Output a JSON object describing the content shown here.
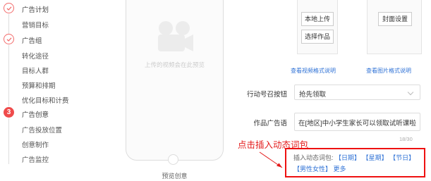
{
  "sidebar": {
    "items": [
      {
        "label": "广告计划",
        "kind": "step-done"
      },
      {
        "label": "营销目标",
        "kind": "sub"
      },
      {
        "label": "广告组",
        "kind": "step-done"
      },
      {
        "label": "转化途径",
        "kind": "sub"
      },
      {
        "label": "目标人群",
        "kind": "sub"
      },
      {
        "label": "预算和排期",
        "kind": "sub"
      },
      {
        "label": "优化目标和计费",
        "kind": "sub"
      },
      {
        "label": "广告创意",
        "kind": "step-active",
        "step_number": "3"
      },
      {
        "label": "广告投放位置",
        "kind": "sub"
      },
      {
        "label": "创意制作",
        "kind": "sub"
      },
      {
        "label": "广告监控",
        "kind": "sub"
      }
    ],
    "accent_color": "#ef4b4b"
  },
  "preview": {
    "placeholder": "上传的视频会在此预览",
    "label": "预览创意"
  },
  "upload": {
    "local_upload": "本地上传",
    "choose_work": "选择作品",
    "cover_setting": "封面设置",
    "video_spec_link": "查看视频格式说明",
    "image_spec_link": "查看图片格式说明"
  },
  "form": {
    "cta_label": "行动号召按钮",
    "cta_value": "抢先领取",
    "copy_label": "作品广告语",
    "copy_value": "在[地区]中小学生家长可以领取试听课啦",
    "counter": "18/30"
  },
  "dynamic_words": {
    "prefix": "插入动态词包:",
    "tags": [
      "【日期】",
      "【星期】",
      "【节日】",
      "【男性女性】"
    ],
    "more": "更多"
  },
  "annotation": {
    "callout": "点击插入动态词包",
    "color": "#e31b1b"
  },
  "colors": {
    "link": "#2f72d6",
    "highlight_box": "#ee1111"
  }
}
